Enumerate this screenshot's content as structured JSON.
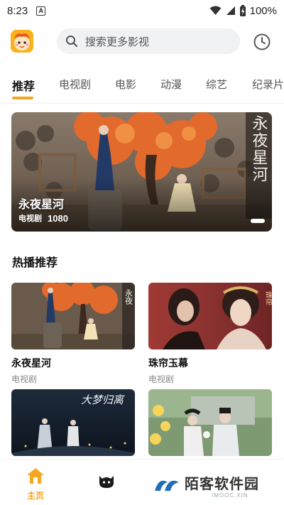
{
  "status_bar": {
    "time": "8:23",
    "notification_glyph": "A",
    "battery_text": "100%"
  },
  "header": {
    "logo_icon": "app-logo-mascot",
    "search_placeholder": "搜索更多影视",
    "search_icon": "search-icon",
    "history_icon": "clock-icon"
  },
  "tabs": [
    {
      "label": "推荐",
      "active": true
    },
    {
      "label": "电视剧",
      "active": false
    },
    {
      "label": "电影",
      "active": false
    },
    {
      "label": "动漫",
      "active": false
    },
    {
      "label": "综艺",
      "active": false
    },
    {
      "label": "纪录片",
      "active": false
    }
  ],
  "banner": {
    "title": "永夜星河",
    "tag": "电视剧",
    "quality": "1080",
    "poster_text": "永夜星河"
  },
  "section": {
    "title": "热播推荐"
  },
  "cards": [
    {
      "title": "永夜星河",
      "subtitle": "电视剧"
    },
    {
      "title": "珠帘玉幕",
      "subtitle": "电视剧"
    },
    {
      "title": "",
      "subtitle": "",
      "poster_text": "大梦归离"
    },
    {
      "title": "",
      "subtitle": ""
    }
  ],
  "bottom_nav": {
    "home_label": "主页",
    "watermark_text": "陌客软件园",
    "watermark_sub": "IMOOC.XIN"
  },
  "colors": {
    "accent": "#f5a623",
    "search_bg": "#f1f2f4",
    "text_muted": "#888888"
  }
}
